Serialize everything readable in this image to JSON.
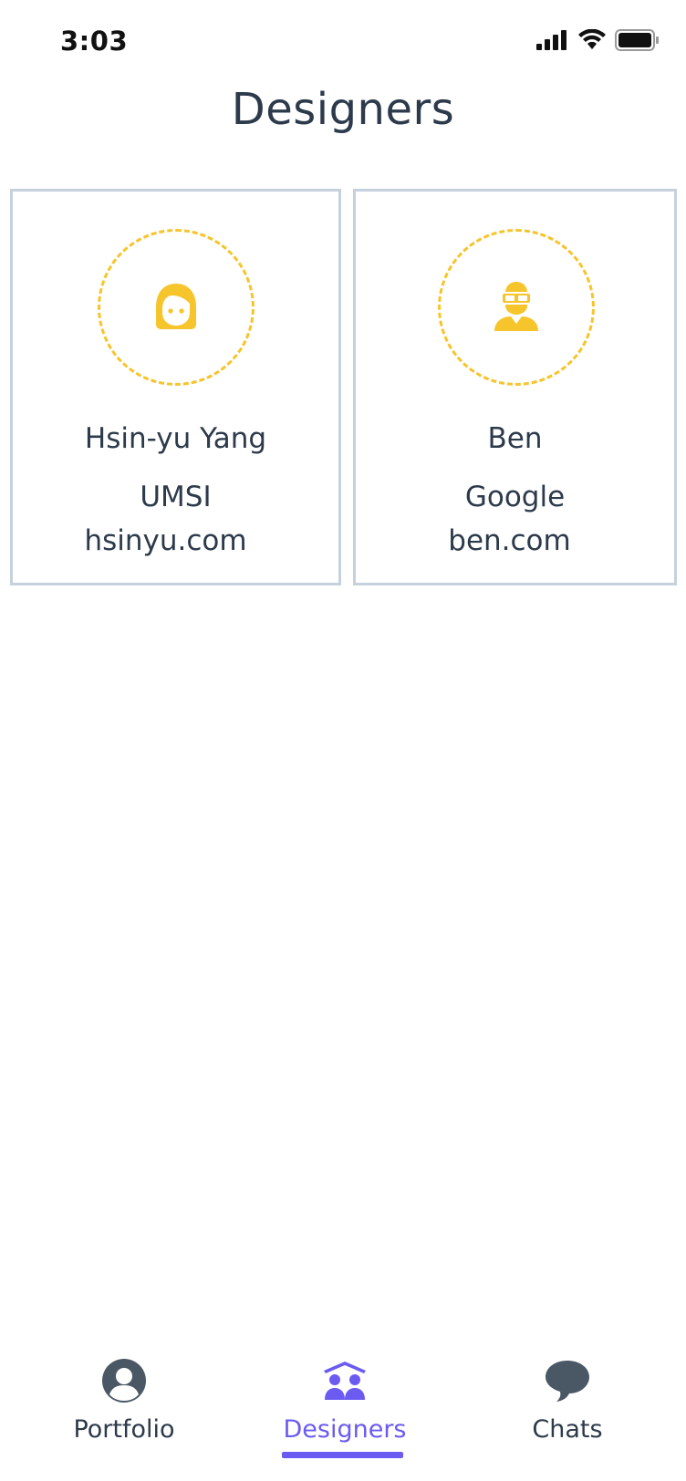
{
  "status_bar": {
    "time": "3:03",
    "signal_icon": "cellular-signal-icon",
    "wifi_icon": "wifi-icon",
    "battery_icon": "battery-icon"
  },
  "header": {
    "title": "Designers"
  },
  "designers": [
    {
      "name": "Hsin-yu Yang",
      "org": "UMSI",
      "site": "hsinyu.com",
      "avatar_icon": "woman-face-icon"
    },
    {
      "name": "Ben",
      "org": "Google",
      "site": "ben.com",
      "avatar_icon": "person-with-goggles-icon"
    }
  ],
  "tabs": [
    {
      "label": "Portfolio",
      "icon": "user-circle-icon",
      "active": false
    },
    {
      "label": "Designers",
      "icon": "people-house-icon",
      "active": true
    },
    {
      "label": "Chats",
      "icon": "chat-bubble-icon",
      "active": false
    }
  ],
  "colors": {
    "accent": "#6b5bf0",
    "avatar_yellow": "#f6c42b",
    "text": "#2c3a4b",
    "card_border": "#c5d1dc",
    "tab_icon": "#4a5866"
  }
}
